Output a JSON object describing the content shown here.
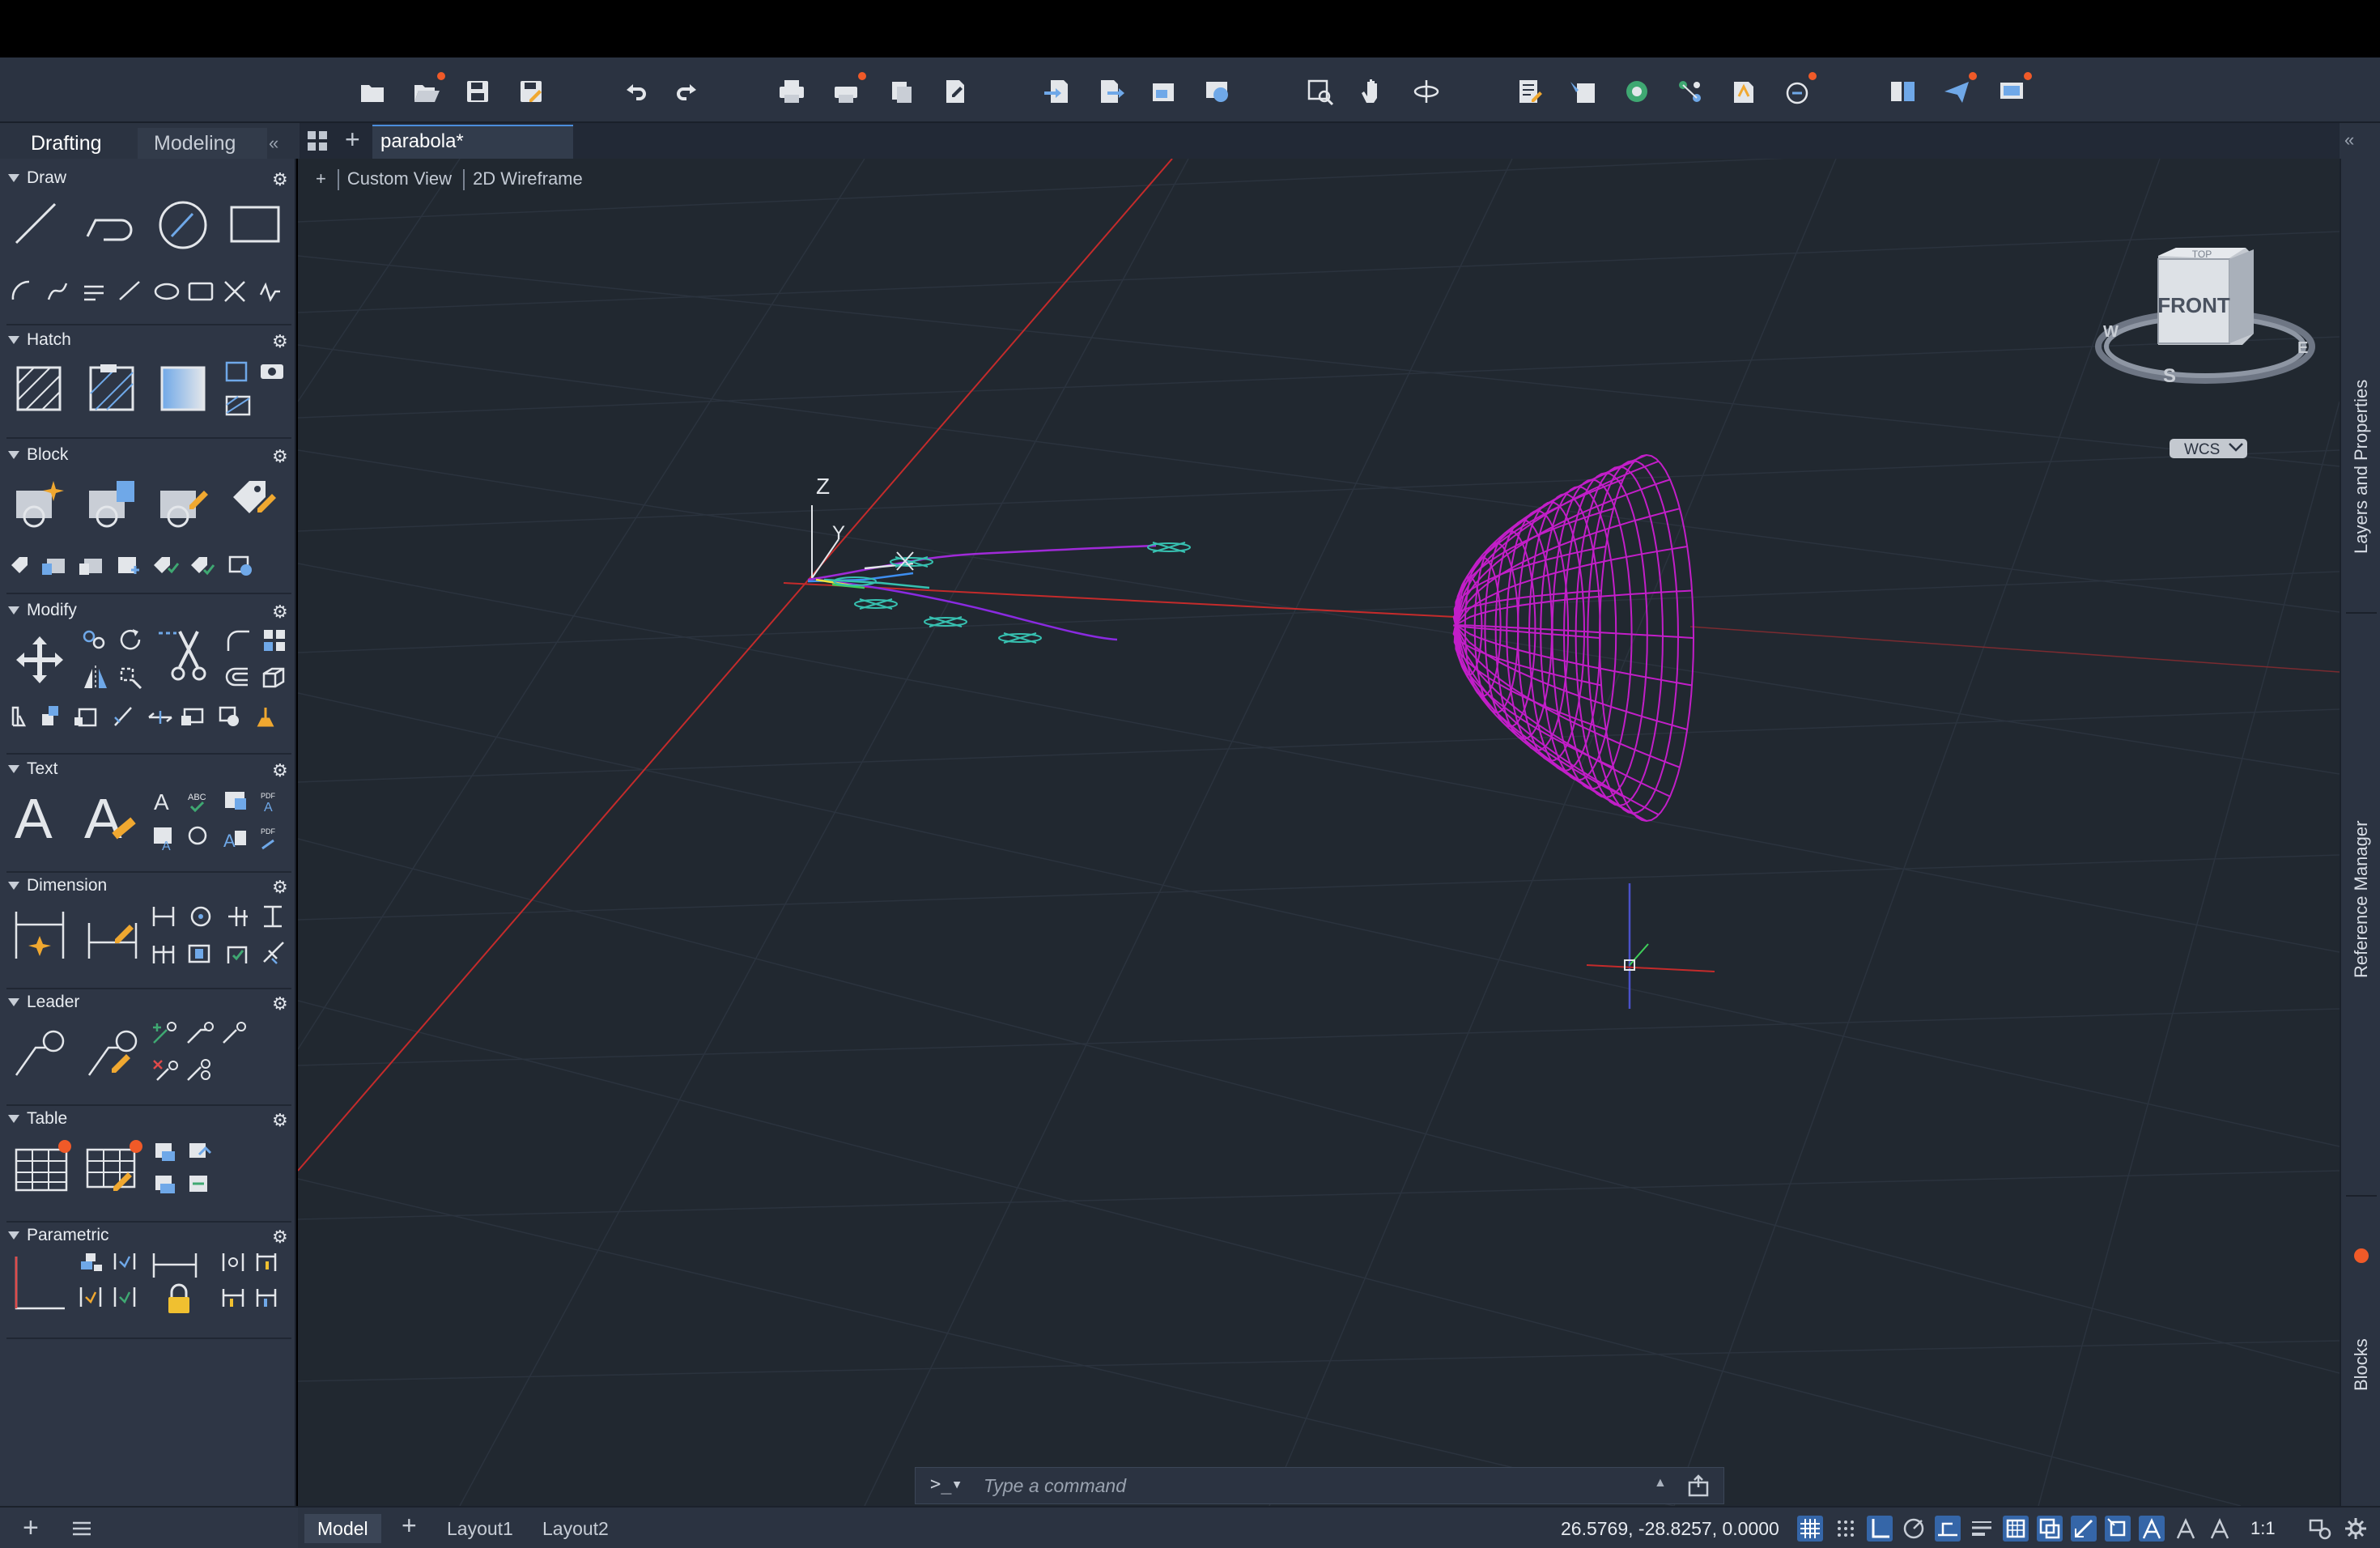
{
  "panel_tabs": {
    "drafting": "Drafting",
    "modeling": "Modeling"
  },
  "file_tab": {
    "name": "parabola*"
  },
  "viewport": {
    "view_name": "Custom View",
    "visual_style": "2D Wireframe",
    "view_cube": {
      "face": "FRONT",
      "top": "TOP",
      "compass": {
        "w": "W",
        "s": "S",
        "e": "E"
      }
    },
    "ucs": "WCS",
    "axis_labels": {
      "z": "Z",
      "y": "Y"
    }
  },
  "sections": [
    {
      "title": "Draw"
    },
    {
      "title": "Hatch"
    },
    {
      "title": "Block"
    },
    {
      "title": "Modify"
    },
    {
      "title": "Text"
    },
    {
      "title": "Dimension"
    },
    {
      "title": "Leader"
    },
    {
      "title": "Table"
    },
    {
      "title": "Parametric"
    }
  ],
  "right_tabs": {
    "layers": "Layers and Properties",
    "reference": "Reference Manager",
    "blocks": "Blocks"
  },
  "command": {
    "prompt": ">_▾",
    "placeholder": "Type a command"
  },
  "layout_tabs": [
    "Model",
    "Layout1",
    "Layout2"
  ],
  "status": {
    "coordinates": "26.5769, -28.8257, 0.0000",
    "scale": "1:1"
  },
  "colors": {
    "accent": "#3566a8",
    "wireframe": "#c21ec8",
    "x_axis": "#c42b2b",
    "notification": "#f05a28"
  }
}
